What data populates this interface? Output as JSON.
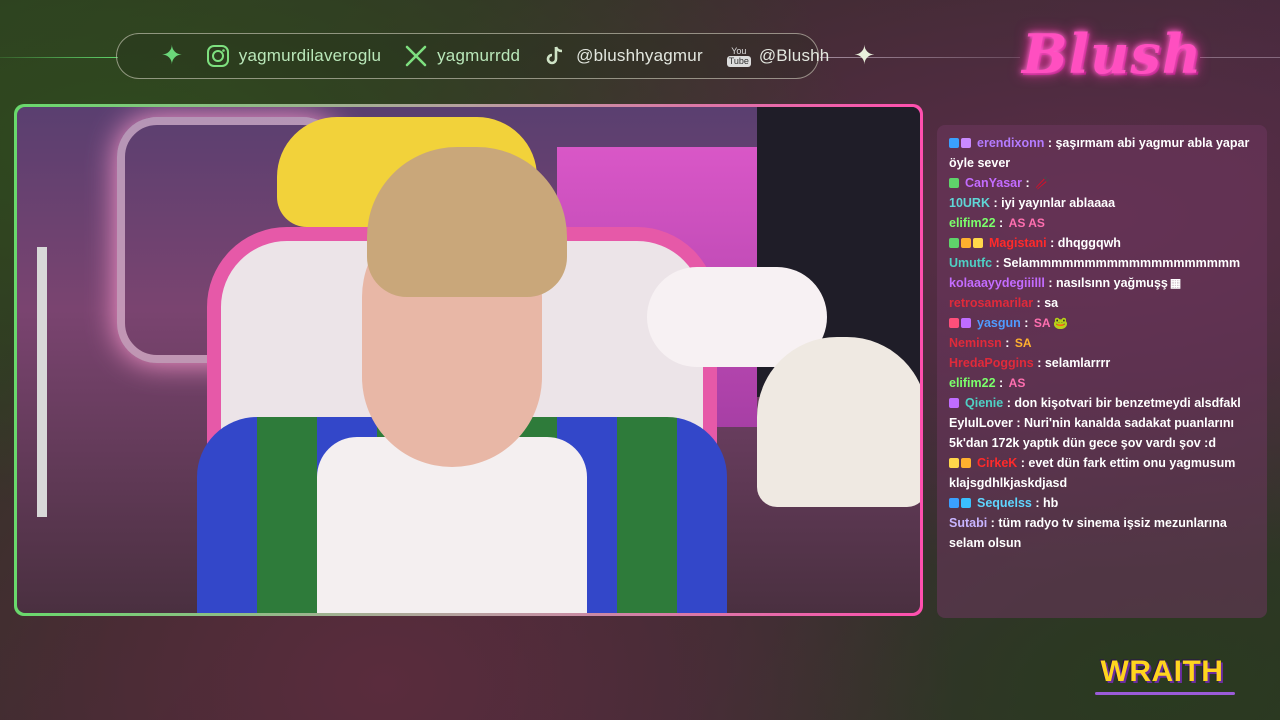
{
  "social": [
    {
      "icon": "instagram-icon",
      "handle": "yagmurdilaveroglu"
    },
    {
      "icon": "x-icon",
      "handle": "yagmurrdd"
    },
    {
      "icon": "tiktok-icon",
      "handle": "@blushhyagmur"
    },
    {
      "icon": "youtube-icon",
      "yt_top": "You",
      "yt_bottom": "Tube",
      "handle": "@Blushh"
    }
  ],
  "logo": "Blush",
  "brand": "WRAITH",
  "colors": {
    "accent_green": "#69d96c",
    "accent_pink": "#ff4fae",
    "chat_bg": "#6e375f"
  },
  "chat": [
    {
      "user": "erendixonn",
      "color": "#b47cff",
      "badges": [
        "#3aa0ff",
        "#c98aff"
      ],
      "text": "şaşırmam abi yagmur abla yapar öyle sever"
    },
    {
      "user": "CanYasar",
      "color": "#c36cff",
      "badges": [
        "#5fd36a"
      ],
      "text": "",
      "emote": "🥢"
    },
    {
      "user": "10URK",
      "color": "#5fd6d6",
      "badges": [],
      "text": "iyi yayınlar ablaaaa"
    },
    {
      "user": "elifim22",
      "color": "#7bff6b",
      "badges": [],
      "text": "",
      "emote": "AS AS",
      "emote_color": "#ff6fb0"
    },
    {
      "user": "Magistani",
      "color": "#ff2a2a",
      "badges": [
        "#5fd36a",
        "#ffb02e",
        "#ffd84a"
      ],
      "text": "dhqggqwh"
    },
    {
      "user": "Umutfc",
      "color": "#4fd0c4",
      "badges": [],
      "text": "Selammmmmmmmmmmmmmmmmmm"
    },
    {
      "user": "kolaaayydegiiilll",
      "color": "#c36cff",
      "badges": [],
      "text": "nasılsınn yağmuşş",
      "emote": "▦"
    },
    {
      "user": "retrosamarilar",
      "color": "#e02a3a",
      "badges": [],
      "text": "sa"
    },
    {
      "user": "yasgun",
      "color": "#4f9bff",
      "badges": [
        "#ff4f7a",
        "#c06cff"
      ],
      "text": "",
      "emote": "SA 🐸",
      "emote_color": "#ff6fb0"
    },
    {
      "user": "Neminsn",
      "color": "#e02a3a",
      "badges": [],
      "text": "",
      "emote": "SA",
      "emote_color": "#ffb02e"
    },
    {
      "user": "HredaPoggins",
      "color": "#e02a3a",
      "badges": [],
      "text": "selamlarrrr"
    },
    {
      "user": "elifim22",
      "color": "#7bff6b",
      "badges": [],
      "text": "",
      "emote": "AS",
      "emote_color": "#ff6fb0"
    },
    {
      "user": "Qienie",
      "color": "#4fd0c4",
      "badges": [
        "#c06cff"
      ],
      "text": "don kişotvari bir benzetmeydi alsdfakl"
    },
    {
      "user": "EylulLover",
      "color": "#ffffff",
      "badges": [],
      "text": "Nuri'nin kanalda sadakat puanlarını 5k'dan 172k yaptık dün gece şov vardı şov :d"
    },
    {
      "user": "CirkeK",
      "color": "#ff2a2a",
      "badges": [
        "#ffd84a",
        "#ffb02e"
      ],
      "text": "evet dün fark ettim onu yagmusum klajsgdhlkjaskdjasd"
    },
    {
      "user": "Sequelss",
      "color": "#5fd6ff",
      "badges": [
        "#3aa0ff",
        "#3ac0ff"
      ],
      "text": "hb"
    },
    {
      "user": "Sutabi",
      "color": "#c8b5ff",
      "badges": [],
      "text": "tüm radyo tv sinema işsiz mezunlarına selam olsun"
    }
  ]
}
